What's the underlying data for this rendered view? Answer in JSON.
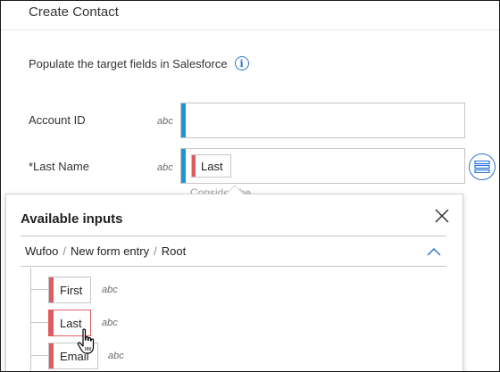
{
  "header": {
    "title": "Create Contact"
  },
  "form": {
    "subtitle": "Populate the target fields in Salesforce",
    "fields": [
      {
        "label": "Account ID",
        "type": "abc",
        "value": ""
      },
      {
        "label": "*Last Name",
        "type": "abc",
        "chip": "Last",
        "hint": "Consider the..."
      }
    ]
  },
  "popover": {
    "title": "Available inputs",
    "breadcrumb": [
      "Wufoo",
      "New form entry",
      "Root"
    ],
    "items": [
      {
        "label": "First",
        "type": "abc"
      },
      {
        "label": "Last",
        "type": "abc"
      },
      {
        "label": "Email",
        "type": "abc"
      }
    ]
  },
  "colors": {
    "accent_blue": "#1d96d8",
    "link_blue": "#2d74da",
    "required_red": "#e05b5f",
    "border_gray": "#c6c6c6"
  },
  "icons": {
    "info": "info-circle-icon",
    "mapping": "mapping-list-icon",
    "close": "close-icon",
    "collapse": "chevron-up-icon",
    "cursor": "hand-pointer-icon"
  }
}
